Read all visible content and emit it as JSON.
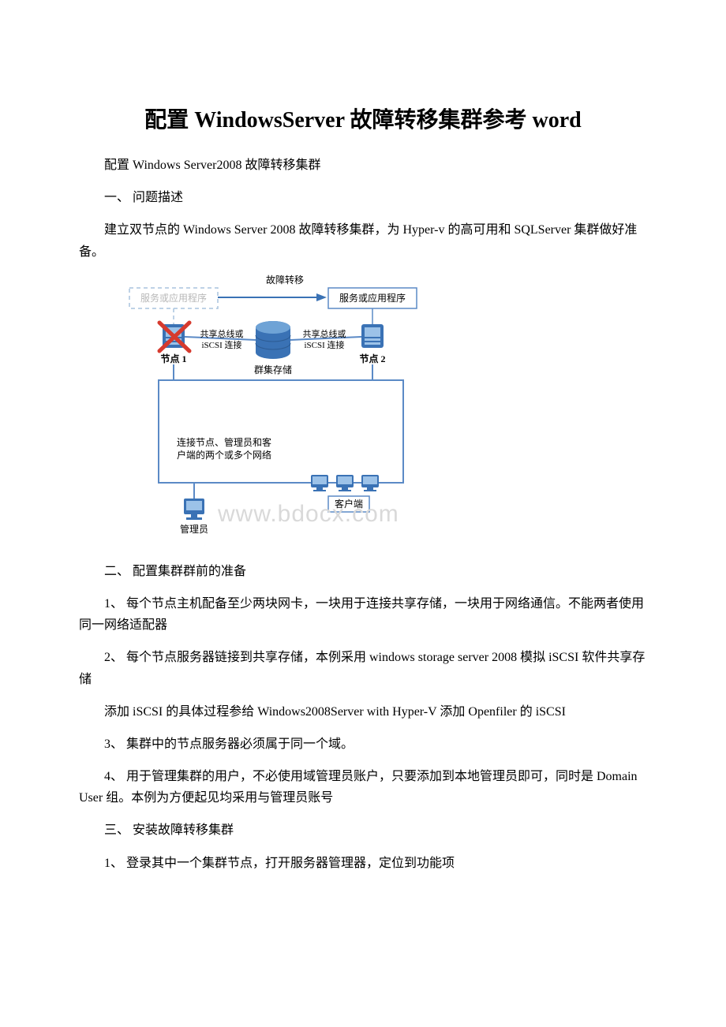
{
  "title": "配置 WindowsServer 故障转移集群参考 word",
  "p_subtitle": "配置 Windows Server2008 故障转移集群",
  "s1_heading": "一、            问题描述",
  "s1_body": "建立双节点的 Windows Server 2008 故障转移集群，为 Hyper-v 的高可用和 SQLServer 集群做好准备。",
  "diagram": {
    "failover_label": "故障转移",
    "service_app_left": "服务或应用程序",
    "service_app_right": "服务或应用程序",
    "shared_bus_left": "共享总线或\niSCSI 连接",
    "shared_bus_right": "共享总线或\niSCSI 连接",
    "cluster_storage": "群集存储",
    "node1": "节点 1",
    "node2": "节点 2",
    "network_text": "连接节点、管理员和客\n户端的两个或多个网络",
    "admin": "管理员",
    "client": "客户端",
    "watermark": "www.bdocx.com"
  },
  "s2_heading": "二、            配置集群群前的准备",
  "s2_item1": "1、  每个节点主机配备至少两块网卡，一块用于连接共享存储，一块用于网络通信。不能两者使用同一网络适配器",
  "s2_item2": "2、  每个节点服务器链接到共享存储，本例采用 windows storage server 2008 模拟 iSCSI 软件共享存储",
  "s2_note": "添加 iSCSI 的具体过程参给 Windows2008Server with Hyper-V 添加 Openfiler 的 iSCSI",
  "s2_item3": "3、  集群中的节点服务器必须属于同一个域。",
  "s2_item4": "4、  用于管理集群的用户，不必使用域管理员账户，只要添加到本地管理员即可，同时是 Domain User 组。本例为方便起见均采用与管理员账号",
  "s3_heading": "三、            安装故障转移集群",
  "s3_item1": "1、  登录其中一个集群节点，打开服务器管理器，定位到功能项"
}
